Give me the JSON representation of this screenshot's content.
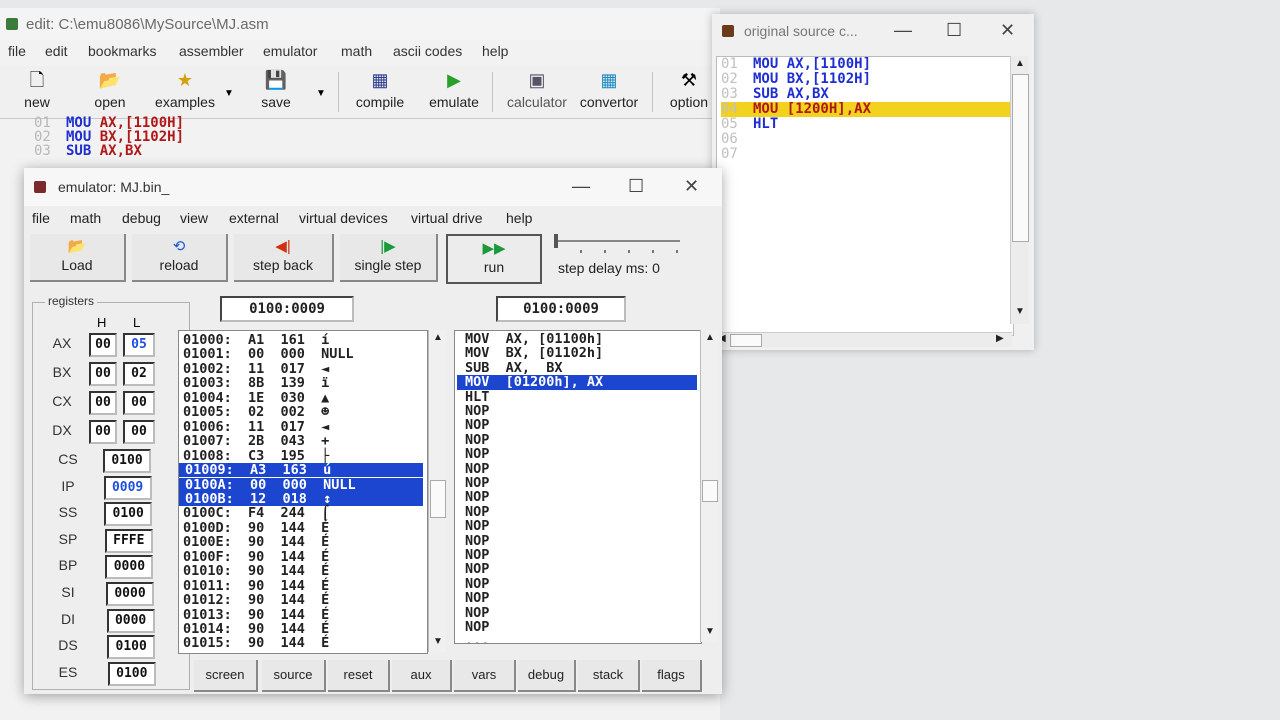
{
  "editor": {
    "title": "edit: C:\\emu8086\\MySource\\MJ.asm",
    "menu": [
      "file",
      "edit",
      "bookmarks",
      "assembler",
      "emulator",
      "math",
      "ascii codes",
      "help"
    ],
    "toolbar": {
      "new": "new",
      "open": "open",
      "examples": "examples",
      "save": "save",
      "compile": "compile",
      "emulate": "emulate",
      "calculator": "calculator",
      "convertor": "convertor",
      "options": "option"
    },
    "code": [
      {
        "ln": "01",
        "op": "MOU",
        "args": "AX,[1100H]"
      },
      {
        "ln": "02",
        "op": "MOU",
        "args": "BX,[1102H]"
      },
      {
        "ln": "03",
        "op": "SUB",
        "args": "AX,BX"
      }
    ]
  },
  "source_window": {
    "title": "original source c...",
    "lines": [
      {
        "ln": "01",
        "text": "MOU AX,[1100H]",
        "highlight": false
      },
      {
        "ln": "02",
        "text": "MOU BX,[1102H]",
        "highlight": false
      },
      {
        "ln": "03",
        "text": "SUB AX,BX",
        "highlight": false
      },
      {
        "ln": "04",
        "text": "MOU [1200H],AX",
        "highlight": true
      },
      {
        "ln": "05",
        "text": "HLT",
        "highlight": false
      },
      {
        "ln": "06",
        "text": "",
        "highlight": false
      },
      {
        "ln": "07",
        "text": "",
        "highlight": false
      }
    ],
    "highlight_color": "#f2d21c"
  },
  "emulator": {
    "title": "emulator: MJ.bin_",
    "menu": [
      "file",
      "math",
      "debug",
      "view",
      "external",
      "virtual devices",
      "virtual drive",
      "help"
    ],
    "buttons": {
      "load": "Load",
      "reload": "reload",
      "step_back": "step back",
      "single_step": "single step",
      "run": "run"
    },
    "step_delay": "step delay ms: 0",
    "step_delay_ms": 0,
    "mem_address": "0100:0009",
    "dis_address": "0100:0009",
    "registers_caption": "registers",
    "reg_headers": {
      "h": "H",
      "l": "L"
    },
    "regs_hl": [
      {
        "name": "AX",
        "h": "00",
        "l": "05"
      },
      {
        "name": "BX",
        "h": "00",
        "l": "02"
      },
      {
        "name": "CX",
        "h": "00",
        "l": "00"
      },
      {
        "name": "DX",
        "h": "00",
        "l": "00"
      }
    ],
    "regs16": [
      {
        "name": "CS",
        "value": "0100"
      },
      {
        "name": "IP",
        "value": "0009"
      },
      {
        "name": "SS",
        "value": "0100"
      },
      {
        "name": "SP",
        "value": "FFFE"
      },
      {
        "name": "BP",
        "value": "0000"
      },
      {
        "name": "SI",
        "value": "0000"
      },
      {
        "name": "DI",
        "value": "0000"
      },
      {
        "name": "DS",
        "value": "0100"
      },
      {
        "name": "ES",
        "value": "0100"
      }
    ],
    "memory": [
      {
        "text": "01000:  A1  161  í",
        "sel": false
      },
      {
        "text": "01001:  00  000  NULL",
        "sel": false
      },
      {
        "text": "01002:  11  017  ◄",
        "sel": false
      },
      {
        "text": "01003:  8B  139  ï",
        "sel": false
      },
      {
        "text": "01004:  1E  030  ▲",
        "sel": false
      },
      {
        "text": "01005:  02  002  ☻",
        "sel": false
      },
      {
        "text": "01006:  11  017  ◄",
        "sel": false
      },
      {
        "text": "01007:  2B  043  +",
        "sel": false
      },
      {
        "text": "01008:  C3  195  ├",
        "sel": false
      },
      {
        "text": "01009:  A3  163  ú",
        "sel": true
      },
      {
        "text": "0100A:  00  000  NULL",
        "sel": true
      },
      {
        "text": "0100B:  12  018  ↕",
        "sel": true
      },
      {
        "text": "0100C:  F4  244  ⌠",
        "sel": false
      },
      {
        "text": "0100D:  90  144  É",
        "sel": false
      },
      {
        "text": "0100E:  90  144  É",
        "sel": false
      },
      {
        "text": "0100F:  90  144  É",
        "sel": false
      },
      {
        "text": "01010:  90  144  É",
        "sel": false
      },
      {
        "text": "01011:  90  144  É",
        "sel": false
      },
      {
        "text": "01012:  90  144  É",
        "sel": false
      },
      {
        "text": "01013:  90  144  É",
        "sel": false
      },
      {
        "text": "01014:  90  144  É",
        "sel": false
      },
      {
        "text": "01015:  90  144  É",
        "sel": false
      }
    ],
    "disasm": [
      {
        "text": "MOV  AX, [01100h]",
        "sel": false
      },
      {
        "text": "MOV  BX, [01102h]",
        "sel": false
      },
      {
        "text": "SUB  AX,  BX",
        "sel": false
      },
      {
        "text": "MOV  [01200h], AX",
        "sel": true
      },
      {
        "text": "HLT",
        "sel": false
      },
      {
        "text": "NOP",
        "sel": false
      },
      {
        "text": "NOP",
        "sel": false
      },
      {
        "text": "NOP",
        "sel": false
      },
      {
        "text": "NOP",
        "sel": false
      },
      {
        "text": "NOP",
        "sel": false
      },
      {
        "text": "NOP",
        "sel": false
      },
      {
        "text": "NOP",
        "sel": false
      },
      {
        "text": "NOP",
        "sel": false
      },
      {
        "text": "NOP",
        "sel": false
      },
      {
        "text": "NOP",
        "sel": false
      },
      {
        "text": "NOP",
        "sel": false
      },
      {
        "text": "NOP",
        "sel": false
      },
      {
        "text": "NOP",
        "sel": false
      },
      {
        "text": "NOP",
        "sel": false
      },
      {
        "text": "NOP",
        "sel": false
      },
      {
        "text": "NOP",
        "sel": false
      },
      {
        "text": "...",
        "sel": false
      }
    ],
    "tabs": [
      "screen",
      "source",
      "reset",
      "aux",
      "vars",
      "debug",
      "stack",
      "flags"
    ]
  },
  "colors": {
    "selection": "#1c46d0",
    "keyword": "#1f2ed0",
    "register": "#b01818"
  }
}
